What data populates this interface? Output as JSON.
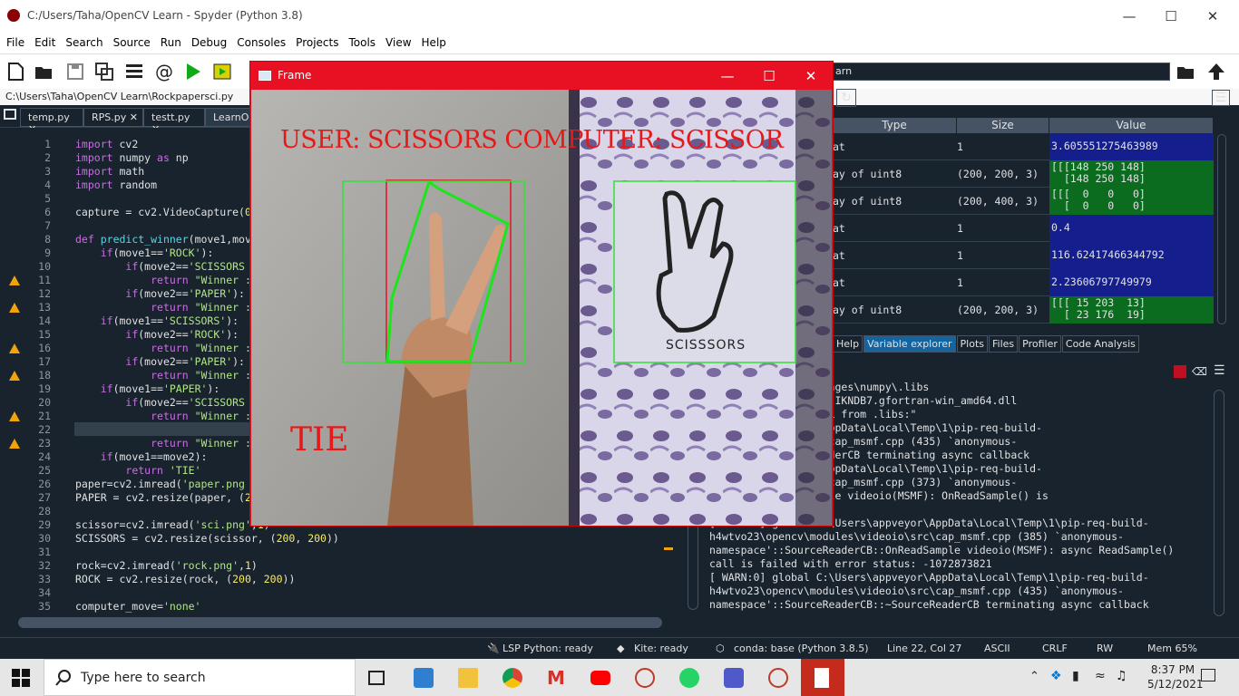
{
  "window": {
    "title": "C:/Users/Taha/OpenCV Learn - Spyder (Python 3.8)"
  },
  "menu": [
    "File",
    "Edit",
    "Search",
    "Source",
    "Run",
    "Debug",
    "Consoles",
    "Projects",
    "Tools",
    "View",
    "Help"
  ],
  "path": "C:\\Users\\Taha\\OpenCV Learn\\Rockpapersci.py",
  "right_path": "arn",
  "editor_tabs": [
    "temp.py",
    "RPS.py",
    "testt.py",
    "LearnOp"
  ],
  "code_lines": [
    {
      "n": "1",
      "t": "import cv2"
    },
    {
      "n": "2",
      "t": "import numpy as np"
    },
    {
      "n": "3",
      "t": "import math"
    },
    {
      "n": "4",
      "t": "import random"
    },
    {
      "n": "5",
      "t": ""
    },
    {
      "n": "6",
      "t": "capture = cv2.VideoCapture(0"
    },
    {
      "n": "7",
      "t": ""
    },
    {
      "n": "8",
      "t": "def predict_winner(move1,mov"
    },
    {
      "n": "9",
      "t": "    if(move1=='ROCK'):"
    },
    {
      "n": "10",
      "t": "        if(move2=='SCISSORS"
    },
    {
      "n": "11",
      "t": "            return \"Winner :"
    },
    {
      "n": "12",
      "t": "        if(move2=='PAPER'):"
    },
    {
      "n": "13",
      "t": "            return \"Winner :"
    },
    {
      "n": "14",
      "t": "    if(move1=='SCISSORS'):"
    },
    {
      "n": "15",
      "t": "        if(move2=='ROCK'):"
    },
    {
      "n": "16",
      "t": "            return \"Winner :"
    },
    {
      "n": "17",
      "t": "        if(move2=='PAPER'):"
    },
    {
      "n": "18",
      "t": "            return \"Winner :"
    },
    {
      "n": "19",
      "t": "    if(move1=='PAPER'):"
    },
    {
      "n": "20",
      "t": "        if(move2=='SCISSORS"
    },
    {
      "n": "21",
      "t": "            return \"Winner :"
    },
    {
      "n": "22",
      "t": "        if(move2=='ROCK'):"
    },
    {
      "n": "23",
      "t": "            return \"Winner :"
    },
    {
      "n": "24",
      "t": "    if(move1==move2):"
    },
    {
      "n": "25",
      "t": "        return 'TIE'"
    },
    {
      "n": "26",
      "t": "paper=cv2.imread('paper.png"
    },
    {
      "n": "27",
      "t": "PAPER = cv2.resize(paper, (2"
    },
    {
      "n": "28",
      "t": ""
    },
    {
      "n": "29",
      "t": "scissor=cv2.imread('sci.png',1)"
    },
    {
      "n": "30",
      "t": "SCISSORS = cv2.resize(scissor, (200, 200))"
    },
    {
      "n": "31",
      "t": ""
    },
    {
      "n": "32",
      "t": "rock=cv2.imread('rock.png',1)"
    },
    {
      "n": "33",
      "t": "ROCK = cv2.resize(rock, (200, 200))"
    },
    {
      "n": "34",
      "t": ""
    },
    {
      "n": "35",
      "t": "computer_move='none'"
    }
  ],
  "variables": {
    "headers": [
      "Type",
      "Size",
      "Value"
    ],
    "rows": [
      {
        "type": "at",
        "size": "1",
        "value": "3.605551275463989",
        "color": "#141e8c"
      },
      {
        "type": "ay of uint8",
        "size": "(200, 200, 3)",
        "value": "[[[148 250 148]\n  [148 250 148]",
        "color": "#0b6b1e"
      },
      {
        "type": "ay of uint8",
        "size": "(200, 400, 3)",
        "value": "[[[  0   0   0]\n  [  0   0   0]",
        "color": "#0b6b1e"
      },
      {
        "type": "at",
        "size": "1",
        "value": "0.4",
        "color": "#141e8c"
      },
      {
        "type": "at",
        "size": "1",
        "value": "116.62417466344792",
        "color": "#141e8c"
      },
      {
        "type": "at",
        "size": "1",
        "value": "2.23606797749979",
        "color": "#141e8c"
      },
      {
        "type": "ay of uint8",
        "size": "(200, 200, 3)",
        "value": "[[[ 15 203  13]\n  [ 23 176  19]",
        "color": "#0b6b1e"
      }
    ]
  },
  "right_tabs": [
    "Help",
    "Variable explorer",
    "Plots",
    "Files",
    "Profiler",
    "Code Analysis"
  ],
  "console_text": "onda3\\lib\\site-packages\\numpy\\.libs\nZYVMPZQ2ME2ZZHJJRJ3JIKNDB7.gfortran-win_amd64.dll\naded more than 1 DLL from .libs:\"\nC:\\Users\\appveyor\\AppData\\Local\\Temp\\1\\pip-req-build-\nodules\\videoio\\src\\cap_msmf.cpp (435) `anonymous-\neaderCB::~SourceReaderCB terminating async callback\nC:\\Users\\appveyor\\AppData\\Local\\Temp\\1\\pip-req-build-\nodules\\videoio\\src\\cap_msmf.cpp (373) `anonymous-\neaderCB::OnReadSample videoio(MSMF): OnReadSample() is\ntatus: -1072873821\n[ WARN:0] global C:\\Users\\appveyor\\AppData\\Local\\Temp\\1\\pip-req-build-\nh4wtvo23\\opencv\\modules\\videoio\\src\\cap_msmf.cpp (385) `anonymous-\nnamespace'::SourceReaderCB::OnReadSample videoio(MSMF): async ReadSample()\ncall is failed with error status: -1072873821\n[ WARN:0] global C:\\Users\\appveyor\\AppData\\Local\\Temp\\1\\pip-req-build-\nh4wtvo23\\opencv\\modules\\videoio\\src\\cap_msmf.cpp (435) `anonymous-\nnamespace'::SourceReaderCB::~SourceReaderCB terminating async callback",
  "frame": {
    "title": "Frame",
    "overlay_text": "USER: SCISSORS COMPUTER: SCISSOR",
    "result": "TIE",
    "card_label": "SCISSSORS"
  },
  "status": {
    "lsp": "LSP Python: ready",
    "kite": "Kite: ready",
    "conda": "conda: base (Python 3.8.5)",
    "position": "Line 22, Col 27",
    "encoding": "ASCII",
    "eol": "CRLF",
    "rw": "RW",
    "mem": "Mem 65%"
  },
  "taskbar": {
    "search_placeholder": "Type here to search",
    "time": "8:37 PM",
    "date": "5/12/2021"
  }
}
